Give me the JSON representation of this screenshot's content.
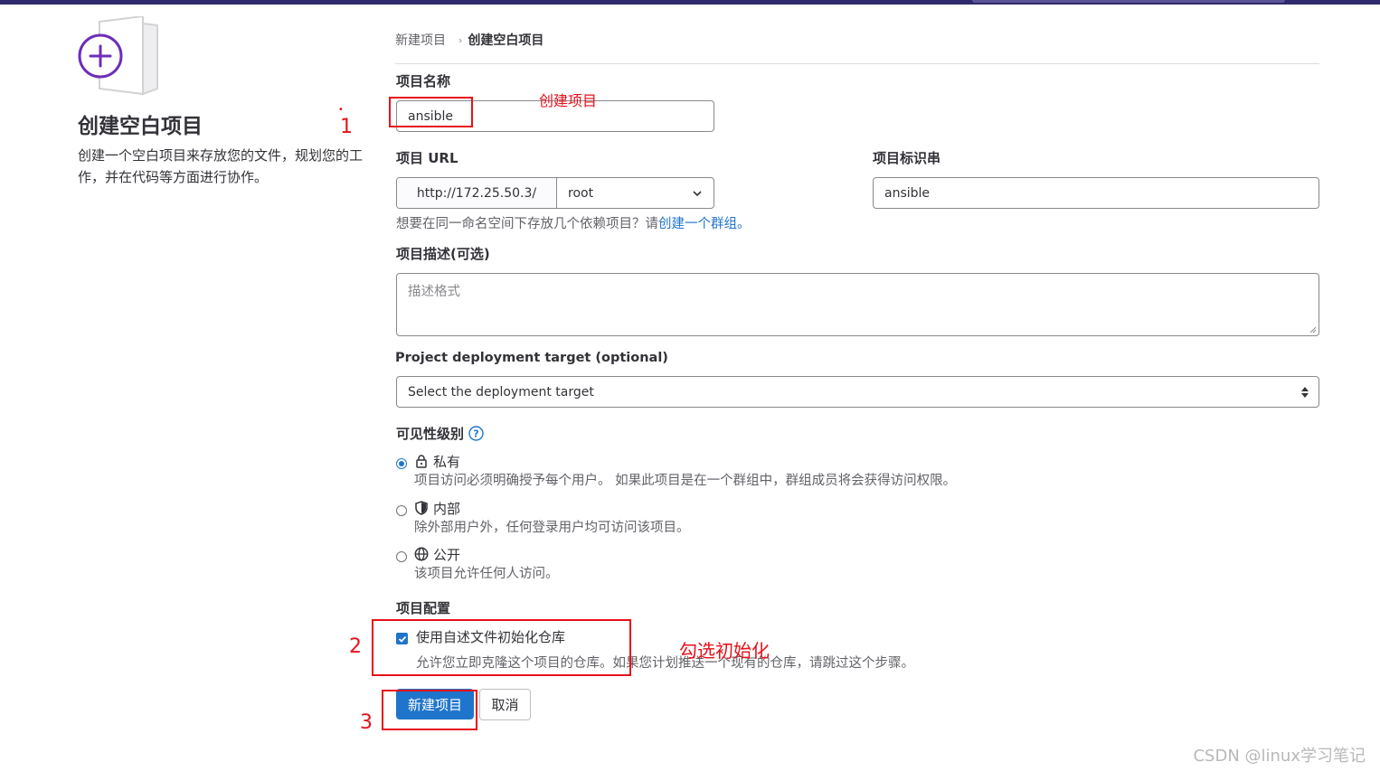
{
  "header": {
    "breadcrumb_parent": "新建项目",
    "breadcrumb_separator": "›",
    "breadcrumb_current": "创建空白项目"
  },
  "left_panel": {
    "title": "创建空白项目",
    "description": "创建一个空白项目来存放您的文件，规划您的工作，并在代码等方面进行协作。"
  },
  "form": {
    "project_name_label": "项目名称",
    "project_name_value": "ansible",
    "project_url_label": "项目 URL",
    "url_prefix": "http://172.25.50.3/",
    "namespace_value": "root",
    "project_slug_label": "项目标识串",
    "project_slug_value": "ansible",
    "group_hint_text": "想要在同一命名空间下存放几个依赖项目？请",
    "group_hint_link": "创建一个群组。",
    "description_label": "项目描述(可选)",
    "description_placeholder": "描述格式",
    "deployment_label": "Project deployment target (optional)",
    "deployment_placeholder": "Select the deployment target",
    "visibility_label": "可见性级别",
    "visibility_options": [
      {
        "icon": "lock-icon",
        "title": "私有",
        "desc": "项目访问必须明确授予每个用户。 如果此项目是在一个群组中，群组成员将会获得访问权限。",
        "checked": true
      },
      {
        "icon": "shield-icon",
        "title": "内部",
        "desc": "除外部用户外，任何登录用户均可访问该项目。",
        "checked": false
      },
      {
        "icon": "globe-icon",
        "title": "公开",
        "desc": "该项目允许任何人访问。",
        "checked": false
      }
    ],
    "config_label": "项目配置",
    "readme_checkbox_label": "使用自述文件初始化仓库",
    "readme_checkbox_checked": true,
    "readme_help": "允许您立即克隆这个项目的仓库。如果您计划推送一个现有的仓库，请跳过这个步骤。"
  },
  "buttons": {
    "create": "新建项目",
    "cancel": "取消"
  },
  "annotations": {
    "name_note": "创建项目",
    "init_note": "勾选初始化",
    "step1": "1",
    "step2": "2",
    "step3": "3"
  },
  "watermark": "CSDN @linux学习笔记",
  "colors": {
    "primary": "#1f75cb",
    "annotation_red": "#e8101a",
    "illustration_purple": "#6e2db8"
  }
}
